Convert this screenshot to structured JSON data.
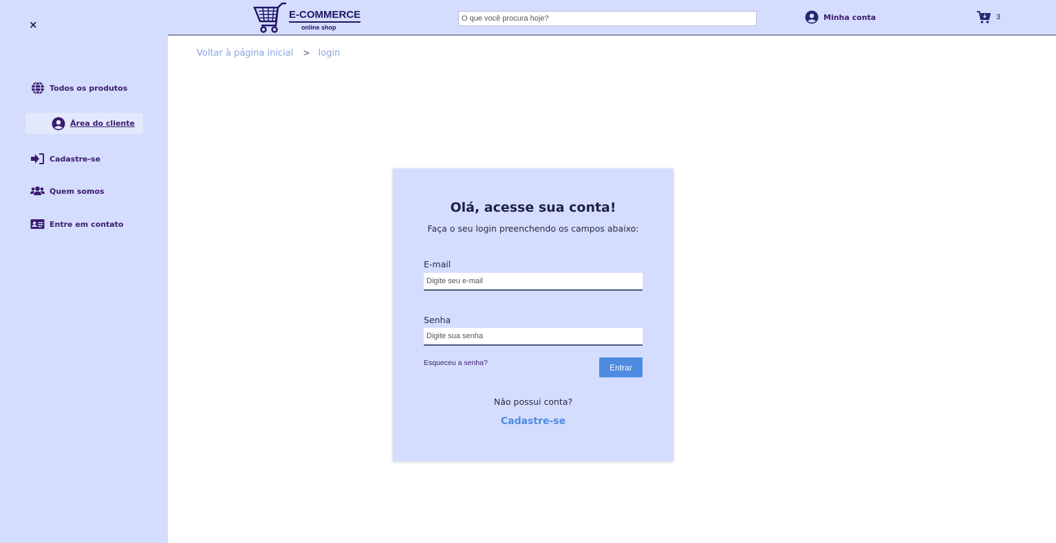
{
  "sidebar": {
    "close_label": "×",
    "items": [
      {
        "label": "Todos os produtos",
        "icon": "globe-icon"
      },
      {
        "label": "Área do cliente",
        "icon": "user-circle-icon",
        "active": true
      },
      {
        "label": "Cadastre-se",
        "icon": "sign-in-icon"
      },
      {
        "label": "Quem somos",
        "icon": "users-icon"
      },
      {
        "label": "Entre em contato",
        "icon": "address-card-icon"
      }
    ]
  },
  "header": {
    "logo_title": "E-COMMERCE",
    "logo_sub": "online shop",
    "search_placeholder": "O que você procura hoje?",
    "account_label": "Minha conta",
    "cart_count": "3"
  },
  "breadcrumb": {
    "home": "Voltar à página inicial",
    "separator": ">",
    "current": "login"
  },
  "login": {
    "title": "Olá, acesse sua conta!",
    "subtitle": "Faça o seu login preenchendo os campos abaixo:",
    "email_label": "E-mail",
    "email_placeholder": "Digite seu e-mail",
    "password_label": "Senha",
    "password_placeholder": "Digite sua senha",
    "forgot_label": "Esqueceu a senha?",
    "enter_label": "Entrar",
    "no_account": "Não possui conta?",
    "register_label": "Cadastre-se"
  },
  "colors": {
    "sidebar_bg": "#d4ddfd",
    "accent": "#4f8be0",
    "nav_text": "#3a1a6e",
    "card_bg": "#d4ddfd"
  }
}
